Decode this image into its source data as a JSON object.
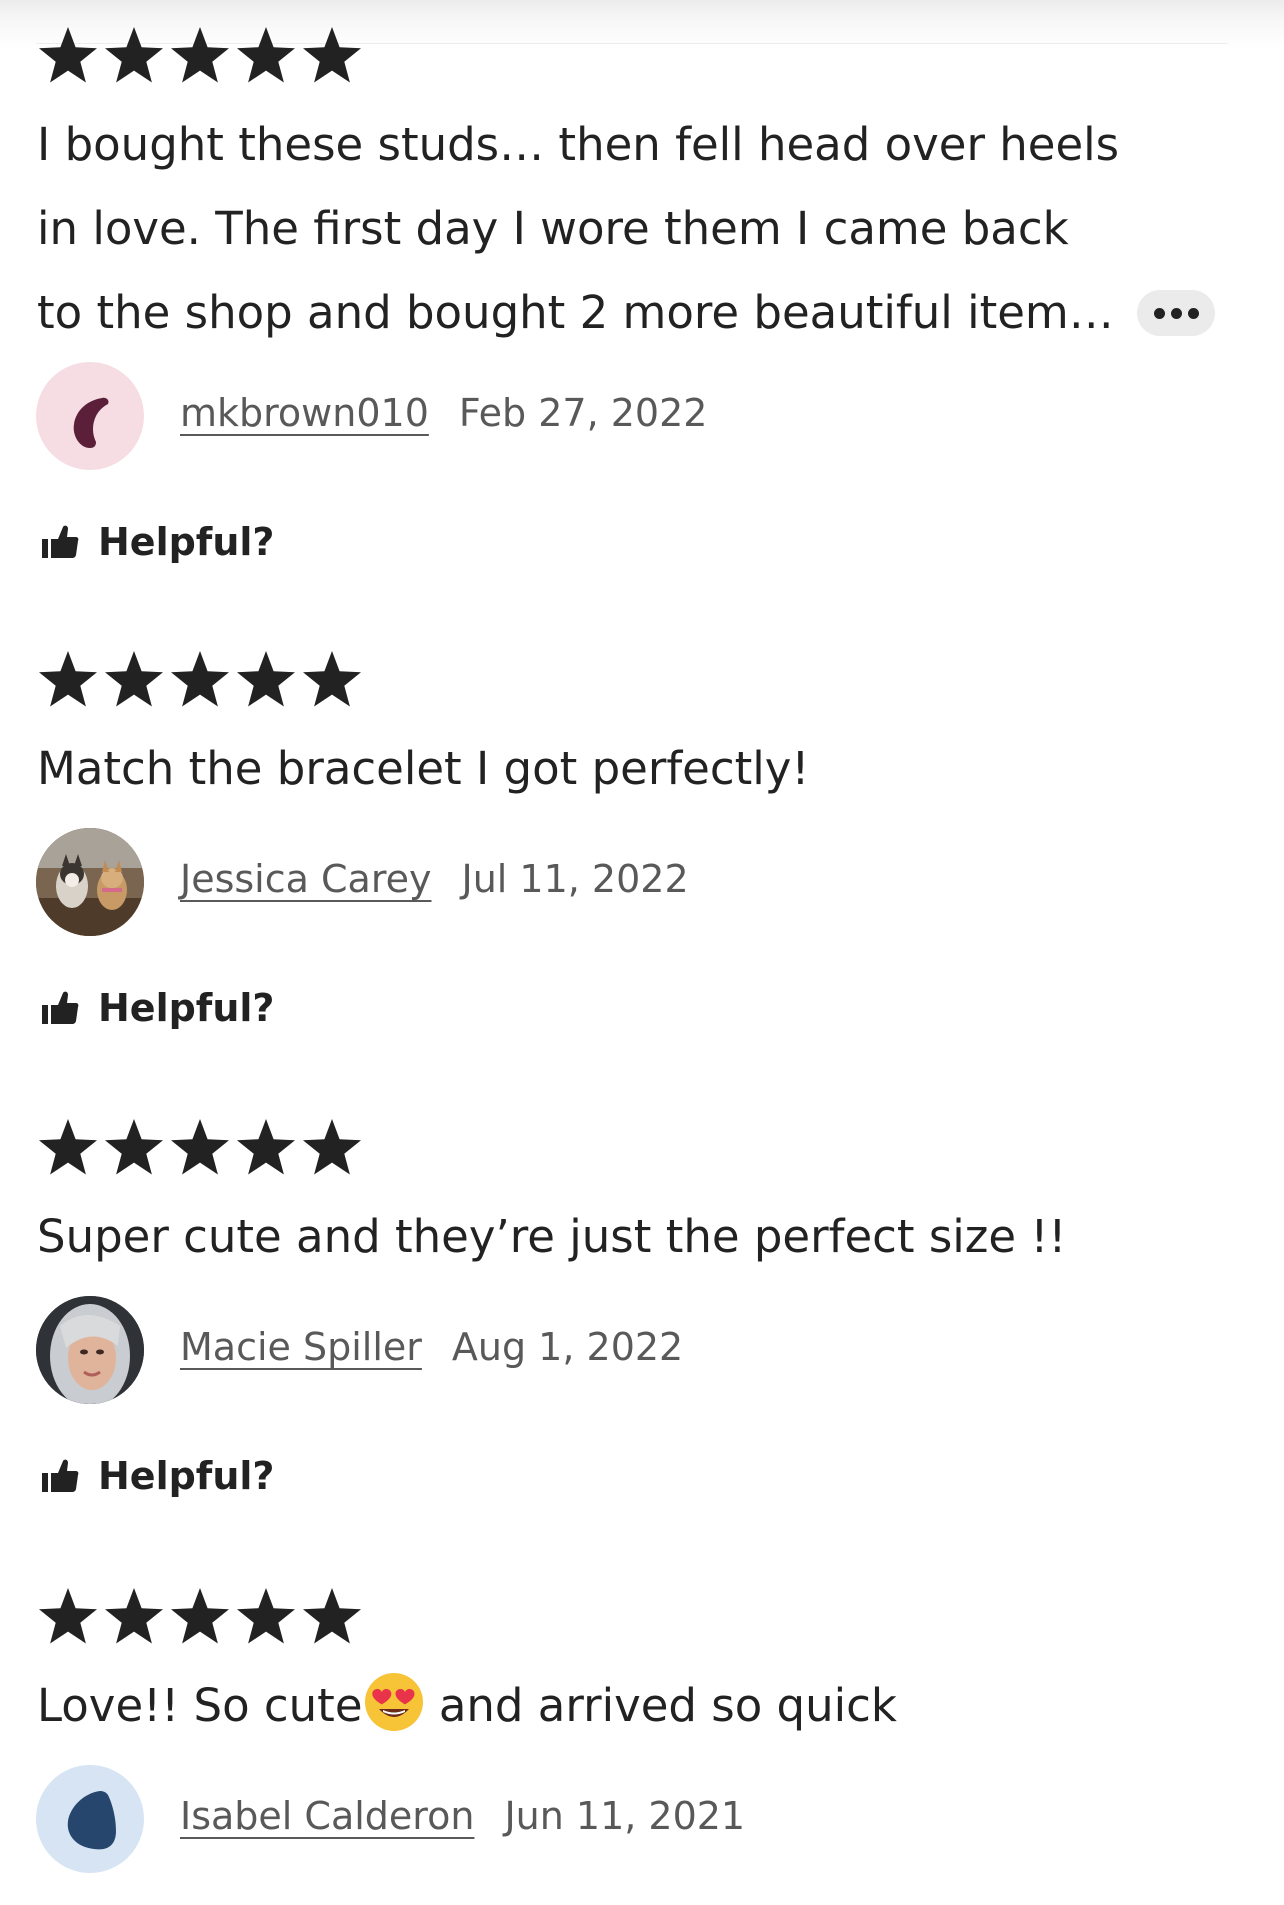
{
  "colors": {
    "text": "#222222",
    "meta_text": "#595959",
    "star": "#222222",
    "more_button_bg": "#ebebeb"
  },
  "reviews": [
    {
      "rating": 5,
      "text_lines": [
        "I bought these studs… then fell head over heels",
        "in love. The first day I wore them I came back",
        "to the shop and bought 2 more beautiful item…"
      ],
      "has_more_button": true,
      "more_icon": "ellipsis-icon",
      "reviewer": {
        "name": "mkbrown010",
        "date": "Feb 27, 2022",
        "avatar": "pink-abstract-avatar"
      },
      "helpful_label": "Helpful?",
      "helpful_icon": "thumbs-up-icon"
    },
    {
      "rating": 5,
      "text_lines": [
        "Match the bracelet I got perfectly!"
      ],
      "has_more_button": false,
      "reviewer": {
        "name": "Jessica Carey",
        "date": "Jul 11, 2022",
        "avatar": "dogs-photo-avatar"
      },
      "helpful_label": "Helpful?",
      "helpful_icon": "thumbs-up-icon"
    },
    {
      "rating": 5,
      "text_lines": [
        "Super cute and they’re just the perfect size !!"
      ],
      "has_more_button": false,
      "reviewer": {
        "name": "Macie Spiller",
        "date": "Aug 1, 2022",
        "avatar": "selfie-photo-avatar"
      },
      "helpful_label": "Helpful?",
      "helpful_icon": "thumbs-up-icon"
    },
    {
      "rating": 5,
      "text_before_emoji": "Love!! So cute",
      "emoji": "heart-eyes-emoji",
      "text_after_emoji": " and arrived so quick",
      "has_more_button": false,
      "reviewer": {
        "name": "Isabel Calderon",
        "date": "Jun 11, 2021",
        "avatar": "blue-abstract-avatar"
      }
    }
  ]
}
